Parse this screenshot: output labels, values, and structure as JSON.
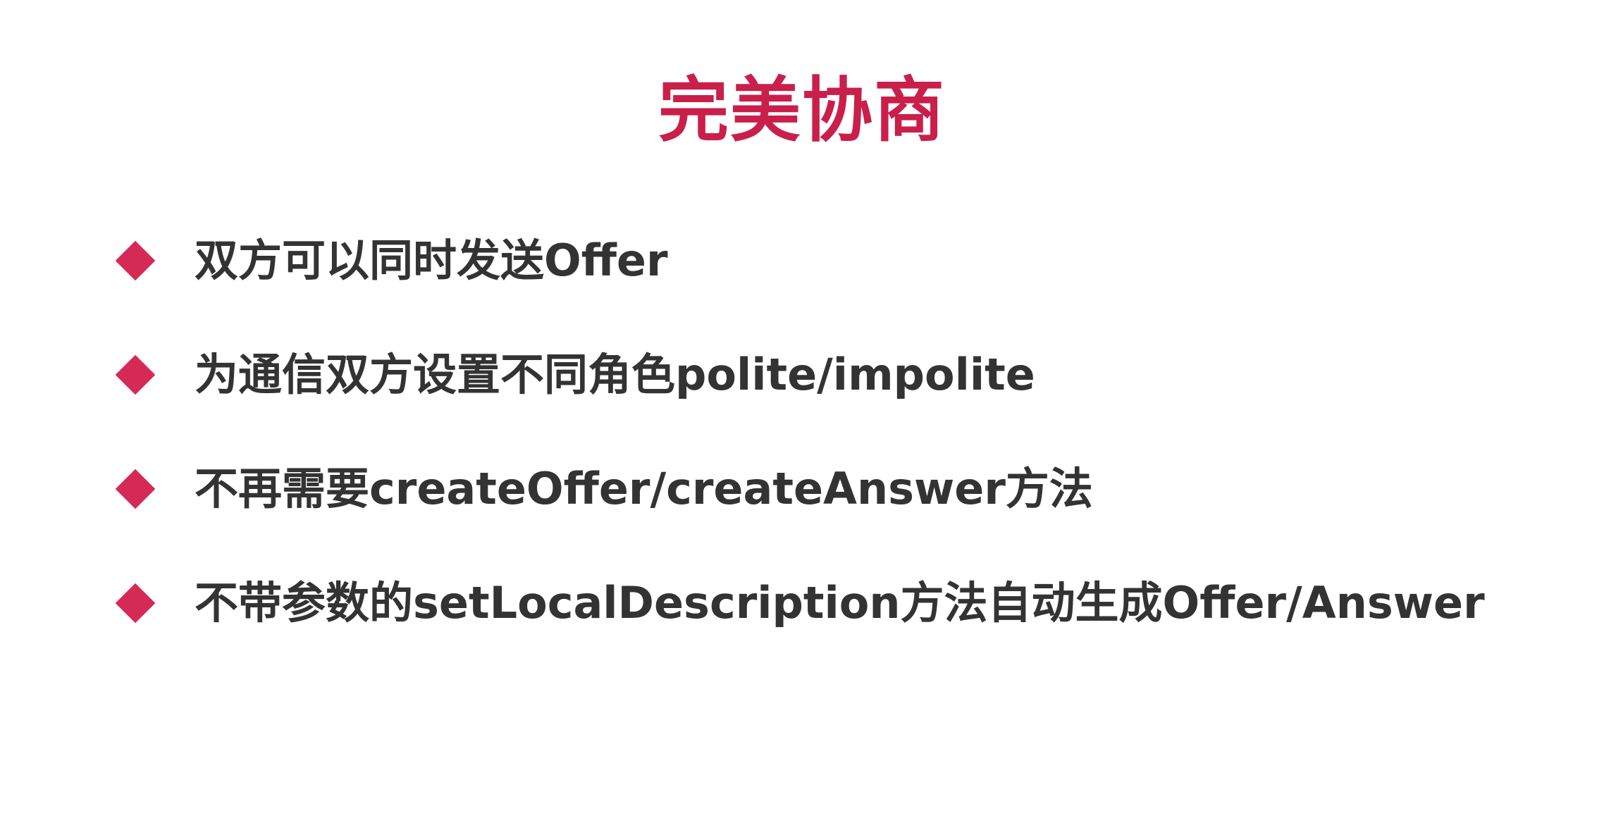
{
  "slide": {
    "title": "完美协商",
    "bullets": [
      {
        "text": "双方可以同时发送Offer"
      },
      {
        "text": "为通信双方设置不同角色polite/impolite"
      },
      {
        "text": "不再需要createOffer/createAnswer方法"
      },
      {
        "text": "不带参数的setLocalDescription方法自动生成Offer/Answer"
      }
    ],
    "colors": {
      "title": "#c91f4a",
      "bullet_marker": "#d52a55",
      "text": "#333333",
      "background": "#ffffff"
    },
    "icons": {
      "bullet_marker": "diamond-icon"
    }
  }
}
